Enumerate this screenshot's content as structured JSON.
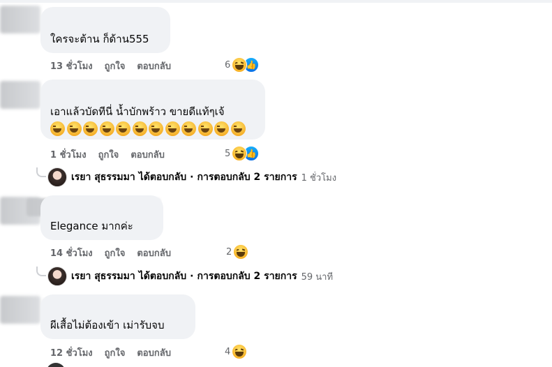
{
  "comments": [
    {
      "text": "ใครจะต้าน ก็ด้าน555",
      "time": "13 ชั่วโมง",
      "like_label": "ถูกใจ",
      "reply_label": "ตอบกลับ",
      "reaction_count": "6",
      "reactions": [
        "haha-icon",
        "like-icon"
      ]
    },
    {
      "text": "เอาแล้วบัดทีนี่ น้ำบักพร้าว ขายดีแท้ๆเจ้",
      "emoji_row_count": 12,
      "time": "1 ชั่วโมง",
      "like_label": "ถูกใจ",
      "reply_label": "ตอบกลับ",
      "reaction_count": "5",
      "reactions": [
        "haha-icon",
        "like-icon"
      ],
      "reply_summary": {
        "name": "เรยา สุธรรมมา",
        "action": "ได้ตอบกลับ",
        "separator": "·",
        "count_label": "การตอบกลับ 2 รายการ",
        "time": "1 ชั่วโมง"
      }
    },
    {
      "text": "Elegance มากค่ะ",
      "time": "14 ชั่วโมง",
      "like_label": "ถูกใจ",
      "reply_label": "ตอบกลับ",
      "reaction_count": "2",
      "reactions": [
        "haha-icon"
      ],
      "reply_summary": {
        "name": "เรยา สุธรรมมา",
        "action": "ได้ตอบกลับ",
        "separator": "·",
        "count_label": "การตอบกลับ 2 รายการ",
        "time": "59 นาที"
      }
    },
    {
      "text": "ผีเสื้อไม่ต้องเข้า เม่ารับจบ",
      "time": "12 ชั่วโมง",
      "like_label": "ถูกใจ",
      "reply_label": "ตอบกลับ",
      "reaction_count": "4",
      "reactions": [
        "haha-icon"
      ]
    }
  ],
  "colors": {
    "bubble": "#f0f2f5",
    "meta_text": "#65676b",
    "text": "#050505",
    "like_blue": "#1877f2",
    "haha_yellow": "#f7b125"
  }
}
